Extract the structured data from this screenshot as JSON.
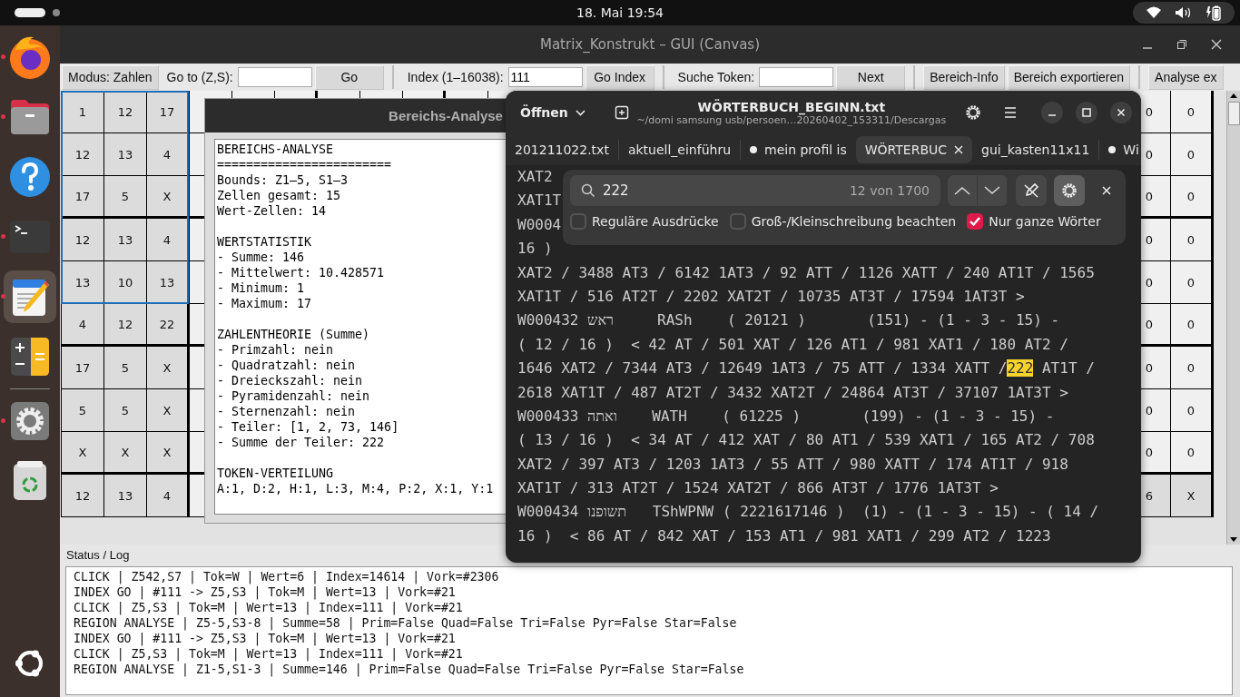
{
  "top_bar": {
    "clock": "18. Mai  19:54"
  },
  "dock": [
    {
      "kind": "browser",
      "running": true,
      "selected": false
    },
    {
      "kind": "folder",
      "running": true,
      "selected": false
    },
    {
      "kind": "help",
      "running": false,
      "selected": false
    },
    {
      "kind": "terminal",
      "running": true,
      "selected": false
    },
    {
      "kind": "editor",
      "running": true,
      "selected": true
    },
    {
      "kind": "calculator",
      "running": false,
      "selected": false
    },
    {
      "kind": "settings",
      "running": true,
      "selected": false
    },
    {
      "kind": "trash",
      "running": false,
      "selected": false
    },
    {
      "kind": "apps",
      "running": false,
      "selected": false
    }
  ],
  "window": {
    "title": "Matrix_Konstrukt – GUI (Canvas)"
  },
  "toolbar": [
    {
      "kind": "button",
      "label": "Modus: Zahlen"
    },
    {
      "kind": "label",
      "label": "Go to (Z,S):"
    },
    {
      "kind": "field"
    },
    {
      "kind": "button",
      "label": "Go"
    },
    {
      "kind": "separator"
    },
    {
      "kind": "label",
      "label": "Index (1–16038):"
    },
    {
      "kind": "field",
      "value": "111"
    },
    {
      "kind": "button",
      "label": "Go Index"
    },
    {
      "kind": "separator"
    },
    {
      "kind": "label",
      "label": "Suche Token:"
    },
    {
      "kind": "field"
    },
    {
      "kind": "button",
      "label": "Next"
    },
    {
      "kind": "separator"
    },
    {
      "kind": "button",
      "label": "Bereich-Info"
    },
    {
      "kind": "button",
      "label": "Bereich exportieren"
    },
    {
      "kind": "separator"
    },
    {
      "kind": "button",
      "label": "Analyse ex"
    }
  ],
  "grid": {
    "rows": [
      {
        "selected": true,
        "left": [
          {
            "text": "1",
            "empty": false
          },
          {
            "text": "12",
            "empty": false
          },
          {
            "text": "17",
            "empty": false
          }
        ],
        "right": [
          {
            "text": "0",
            "empty": true
          },
          {
            "text": "0",
            "empty": true
          }
        ]
      },
      {
        "selected": true,
        "left": [
          {
            "text": "12",
            "empty": false
          },
          {
            "text": "13",
            "empty": false
          },
          {
            "text": "4",
            "empty": false
          }
        ],
        "right": [
          {
            "text": "0",
            "empty": true
          },
          {
            "text": "0",
            "empty": true
          }
        ]
      },
      {
        "selected": true,
        "left": [
          {
            "text": "17",
            "empty": false
          },
          {
            "text": "5",
            "empty": false
          },
          {
            "text": "X",
            "empty": false
          }
        ],
        "right": [
          {
            "text": "0",
            "empty": true
          },
          {
            "text": "0",
            "empty": true
          }
        ]
      },
      {
        "selected": true,
        "left": [
          {
            "text": "12",
            "empty": false
          },
          {
            "text": "13",
            "empty": false
          },
          {
            "text": "4",
            "empty": false
          }
        ],
        "right": [
          {
            "text": "0",
            "empty": true
          },
          {
            "text": "0",
            "empty": true
          }
        ]
      },
      {
        "selected": true,
        "left": [
          {
            "text": "13",
            "empty": false
          },
          {
            "text": "10",
            "empty": false
          },
          {
            "text": "13",
            "empty": false
          }
        ],
        "right": [
          {
            "text": "0",
            "empty": true
          },
          {
            "text": "0",
            "empty": true
          }
        ]
      },
      {
        "selected": false,
        "left": [
          {
            "text": "4",
            "empty": false
          },
          {
            "text": "12",
            "empty": false
          },
          {
            "text": "22",
            "empty": false
          }
        ],
        "right": [
          {
            "text": "0",
            "empty": true
          },
          {
            "text": "0",
            "empty": true
          }
        ]
      },
      {
        "selected": false,
        "left": [
          {
            "text": "17",
            "empty": false
          },
          {
            "text": "5",
            "empty": false
          },
          {
            "text": "X",
            "empty": false
          }
        ],
        "right": [
          {
            "text": "0",
            "empty": true
          },
          {
            "text": "0",
            "empty": true
          }
        ]
      },
      {
        "selected": false,
        "left": [
          {
            "text": "5",
            "empty": false
          },
          {
            "text": "5",
            "empty": false
          },
          {
            "text": "X",
            "empty": false
          }
        ],
        "right": [
          {
            "text": "0",
            "empty": true
          },
          {
            "text": "0",
            "empty": true
          }
        ]
      },
      {
        "selected": false,
        "left": [
          {
            "text": "X",
            "empty": false
          },
          {
            "text": "X",
            "empty": false
          },
          {
            "text": "X",
            "empty": false
          }
        ],
        "right": [
          {
            "text": "0",
            "empty": true
          },
          {
            "text": "0",
            "empty": true
          }
        ]
      },
      {
        "selected": false,
        "left": [
          {
            "text": "12",
            "empty": false
          },
          {
            "text": "13",
            "empty": false
          },
          {
            "text": "4",
            "empty": false
          }
        ],
        "right": [
          {
            "text": "6",
            "empty": false
          },
          {
            "text": "X",
            "empty": false
          }
        ]
      }
    ]
  },
  "status": {
    "label": "Status / Log",
    "lines": [
      "CLICK | Z542,S7 | Tok=W | Wert=6 | Index=14614 | Vork=#2306",
      "INDEX GO | #111 -> Z5,S3 | Tok=M | Wert=13 | Vork=#21",
      "CLICK | Z5,S3 | Tok=M | Wert=13 | Index=111 | Vork=#21",
      "REGION ANALYSE | Z5-5,S3-8 | Summe=58 | Prim=False Quad=False Tri=False Pyr=False Star=False",
      "INDEX GO | #111 -> Z5,S3 | Tok=M | Wert=13 | Vork=#21",
      "CLICK | Z5,S3 | Tok=M | Wert=13 | Index=111 | Vork=#21",
      "REGION ANALYSE | Z1-5,S1-3 | Summe=146 | Prim=False Quad=False Tri=False Pyr=False Star=False"
    ]
  },
  "analysis_dialog": {
    "title": "Bereichs-Analyse",
    "sections": [
      [
        "BEREICHS-ANALYSE",
        "========================",
        "Bounds: Z1–5, S1–3",
        "Zellen gesamt: 15",
        "Wert-Zellen: 14"
      ],
      [
        "WERTSTATISTIK",
        "- Summe: 146",
        "- Mittelwert: 10.428571",
        "- Minimum: 1",
        "- Maximum: 17"
      ],
      [
        "ZAHLENTHEORIE (Summe)",
        "- Primzahl: nein",
        "- Quadratzahl: nein",
        "- Dreieckszahl: nein",
        "- Pyramidenzahl: nein",
        "- Sternenzahl: nein",
        "- Teiler: [1, 2, 73, 146]",
        "- Summe der Teiler: 222"
      ],
      [
        "TOKEN-VERTEILUNG",
        "A:1, D:2, H:1, L:3, M:4, P:2, X:1, Y:1"
      ]
    ]
  },
  "editor": {
    "open_label": "Öffnen",
    "title": "WÖRTERBUCH_BEGINN.txt",
    "subtitle": "~/domi samsung usb/persoen…20260402_153311/Descargas",
    "tabs": [
      {
        "label": "201211022.txt",
        "modified": false,
        "selected": false,
        "closable": false
      },
      {
        "label": "aktuell_einführu",
        "modified": false,
        "selected": false,
        "closable": false
      },
      {
        "label": "mein profil is",
        "modified": true,
        "selected": false,
        "closable": false
      },
      {
        "label": "WÖRTERBUC",
        "modified": false,
        "selected": true,
        "closable": true
      },
      {
        "label": "gui_kasten11x11",
        "modified": false,
        "selected": false,
        "closable": false
      },
      {
        "label": "Wi",
        "modified": true,
        "selected": false,
        "closable": false
      }
    ],
    "search": {
      "query": "222",
      "count": "12 von 1700",
      "options": [
        {
          "label": "Reguläre Ausdrücke",
          "checked": false
        },
        {
          "label": "Groß-/Kleinschreibung beachten",
          "checked": false
        },
        {
          "label": "Nur ganze Wörter",
          "checked": true
        }
      ]
    },
    "lines": [
      {
        "text": "XAT2"
      },
      {
        "text": "XAT1T"
      },
      {
        "text": "W0004"
      },
      {
        "text": "16 )"
      },
      {
        "text": "XAT2 / 3488 AT3 / 6142 1AT3 / 92 ATT / 1126 XATT / 240 AT1T / 1565"
      },
      {
        "text": "XAT1T / 516 AT2T / 2202 XAT2T / 10735 AT3T / 17594 1AT3T >"
      },
      {
        "text": "W000432 ראש     RASh    ( 20121 )       (151) - (1 - 3 - 15) -"
      },
      {
        "text": "( 12 / 16 )  < 42 AT / 501 XAT / 126 AT1 / 981 XAT1 / 180 AT2 /"
      },
      {
        "text": "1646 XAT2 / 7344 AT3 / 12649 1AT3 / 75 ATT / 1334 XATT /",
        "match": "222",
        "after": "AT1T /"
      },
      {
        "text": "2618 XAT1T / 487 AT2T / 3432 XAT2T / 24864 AT3T / 37107 1AT3T >"
      },
      {
        "text": "W000433 ואתה    WATH    ( 61225 )       (199) - (1 - 3 - 15) -"
      },
      {
        "text": "( 13 / 16 )  < 34 AT / 412 XAT / 80 AT1 / 539 XAT1 / 165 AT2 / 708"
      },
      {
        "text": "XAT2 / 397 AT3 / 1203 1AT3 / 55 ATT / 980 XATT / 174 AT1T / 918"
      },
      {
        "text": "XAT1T / 313 AT2T / 1524 XAT2T / 866 AT3T / 1776 1AT3T >"
      },
      {
        "text": "W000434 תשופנו   TShWPNW ( 2221617146 )  (1) - (1 - 3 - 15) - ( 14 /"
      },
      {
        "text": "16 )  < 86 AT / 842 XAT / 153 AT1 / 981 XAT1 / 299 AT2 / 1223"
      }
    ]
  }
}
